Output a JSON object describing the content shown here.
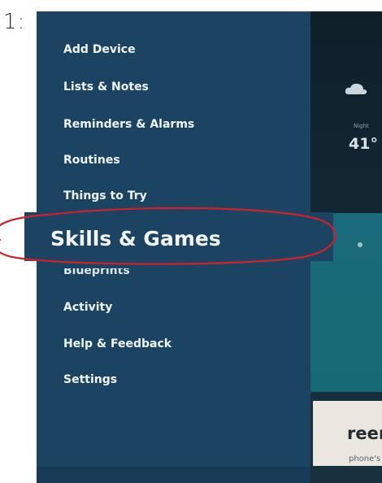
{
  "step": {
    "label": "1:"
  },
  "background": {
    "weather_small_text": "Night",
    "weather_temp": "41°",
    "card_title": "reen",
    "card_subtitle": "phone's"
  },
  "menu": {
    "items": [
      {
        "label": "Add Device"
      },
      {
        "label": "Lists & Notes"
      },
      {
        "label": "Reminders & Alarms"
      },
      {
        "label": "Routines"
      },
      {
        "label": "Things to Try"
      },
      {
        "label": "Blueprints"
      },
      {
        "label": "Activity"
      },
      {
        "label": "Help & Feedback"
      },
      {
        "label": "Settings"
      }
    ],
    "highlighted": {
      "label": "Skills & Games"
    }
  },
  "colors": {
    "drawer": "#1b4463",
    "annotation_ring": "#d21f2a",
    "teal_card": "#1a6a7c"
  },
  "icons": {
    "weather": "cloud-icon"
  }
}
